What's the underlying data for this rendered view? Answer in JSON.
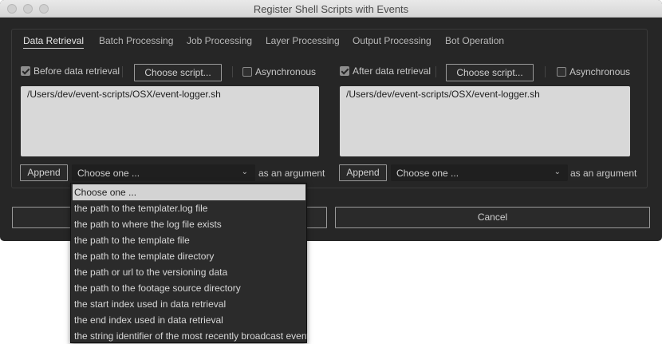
{
  "window": {
    "title": "Register Shell Scripts with Events"
  },
  "tabs": [
    {
      "label": "Data Retrieval",
      "active": true
    },
    {
      "label": "Batch Processing"
    },
    {
      "label": "Job Processing"
    },
    {
      "label": "Layer Processing"
    },
    {
      "label": "Output Processing"
    },
    {
      "label": "Bot Operation"
    }
  ],
  "before": {
    "checkbox_label": "Before data retrieval",
    "checked": true,
    "choose_label": "Choose script...",
    "async_label": "Asynchronous",
    "async_checked": false,
    "script_path": "/Users/dev/event-scripts/OSX/event-logger.sh",
    "append_label": "Append",
    "select_value": "Choose one ...",
    "suffix": "as an argument"
  },
  "after": {
    "checkbox_label": "After data retrieval",
    "checked": true,
    "choose_label": "Choose script...",
    "async_label": "Asynchronous",
    "async_checked": false,
    "script_path": "/Users/dev/event-scripts/OSX/event-logger.sh",
    "append_label": "Append",
    "select_value": "Choose one ...",
    "suffix": "as an argument"
  },
  "footer": {
    "cancel_label": "Cancel"
  },
  "dropdown": {
    "options": [
      "Choose one ...",
      "the path to the templater.log file",
      "the path to where the log file exists",
      "the path to the template file",
      "the path to the template directory",
      "the path or url to the versioning data",
      "the path to the footage source directory",
      "the start index used in data retrieval",
      "the end index used in data retrieval",
      "the string identifier of the most recently broadcast event"
    ]
  }
}
